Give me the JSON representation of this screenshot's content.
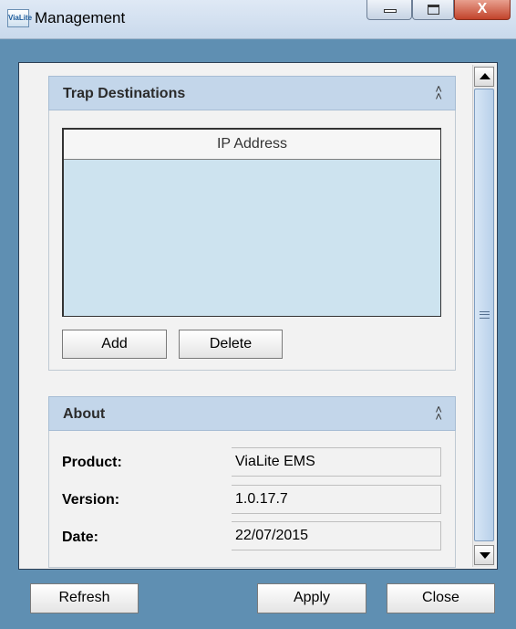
{
  "window": {
    "title": "Management",
    "icon": "ViaLite",
    "close_glyph": "X"
  },
  "trap_panel": {
    "title": "Trap Destinations",
    "collapse_icon": "chevron-double-up-icon",
    "table": {
      "columns": [
        "IP Address"
      ],
      "rows": []
    },
    "add_label": "Add",
    "delete_label": "Delete"
  },
  "about_panel": {
    "title": "About",
    "collapse_icon": "chevron-double-up-icon",
    "fields": [
      {
        "label": "Product:",
        "value": "ViaLite EMS"
      },
      {
        "label": "Version:",
        "value": "1.0.17.7"
      },
      {
        "label": "Date:",
        "value": "22/07/2015"
      }
    ]
  },
  "footer": {
    "refresh_label": "Refresh",
    "apply_label": "Apply",
    "close_label": "Close"
  },
  "colors": {
    "frame": "#5f8fb2",
    "panel_header": "#c3d6ea",
    "table_body": "#cde3ef"
  }
}
